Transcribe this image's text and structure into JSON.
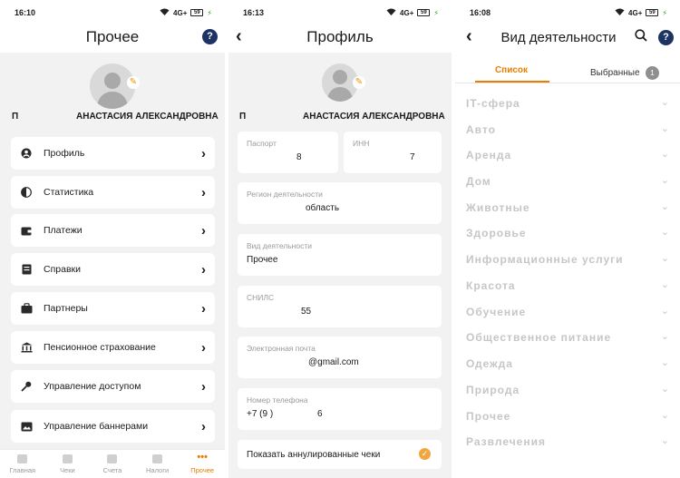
{
  "screen1": {
    "status_time": "16:10",
    "title": "Прочее",
    "user_initial": "П",
    "user_name": "АНАСТАСИЯ АЛЕКСАНДРОВНА",
    "menu": [
      {
        "label": "Профиль",
        "icon": "person-icon"
      },
      {
        "label": "Статистика",
        "icon": "pie-chart-icon"
      },
      {
        "label": "Платежи",
        "icon": "wallet-icon"
      },
      {
        "label": "Справки",
        "icon": "document-icon"
      },
      {
        "label": "Партнеры",
        "icon": "briefcase-icon"
      },
      {
        "label": "Пенсионное страхование",
        "icon": "bank-icon"
      },
      {
        "label": "Управление доступом",
        "icon": "key-icon"
      },
      {
        "label": "Управление баннерами",
        "icon": "banner-icon"
      }
    ],
    "tabs": [
      {
        "label": "Главная"
      },
      {
        "label": "Чеки"
      },
      {
        "label": "Счета"
      },
      {
        "label": "Налоги"
      },
      {
        "label": "Прочее"
      }
    ],
    "active_tab": "Прочее",
    "accent_color": "#e87d00"
  },
  "screen2": {
    "status_time": "16:13",
    "title": "Профиль",
    "user_initial": "П",
    "user_name": "АНАСТАСИЯ АЛЕКСАНДРОВНА",
    "fields": {
      "passport_label": "Паспорт",
      "passport_value": "8",
      "inn_label": "ИНН",
      "inn_value": "7",
      "region_label": "Регион деятельности",
      "region_value": "область",
      "activity_label": "Вид деятельности",
      "activity_value": "Прочее",
      "snils_label": "СНИЛС",
      "snils_value": "55",
      "email_label": "Электронная почта",
      "email_value": "@gmail.com",
      "phone_label": "Номер телефона",
      "phone_value_prefix": "+7 (9 )",
      "phone_value_suffix": "6",
      "show_cancelled_label": "Показать аннулированные чеки"
    }
  },
  "screen3": {
    "status_time": "16:08",
    "title": "Вид деятельности",
    "tab_list": "Список",
    "tab_favorites": "Выбранные",
    "favorites_count": "1",
    "categories": [
      "IT-сфера",
      "Авто",
      "Аренда",
      "Дом",
      "Животные",
      "Здоровье",
      "Информационные услуги",
      "Красота",
      "Обучение",
      "Общественное питание",
      "Одежда",
      "Природа",
      "Прочее",
      "Развлечения"
    ]
  },
  "status_icons": {
    "signal": "4G+",
    "battery": "59"
  },
  "colors": {
    "help_badge": "#1c3363",
    "accent": "#e87d00"
  }
}
